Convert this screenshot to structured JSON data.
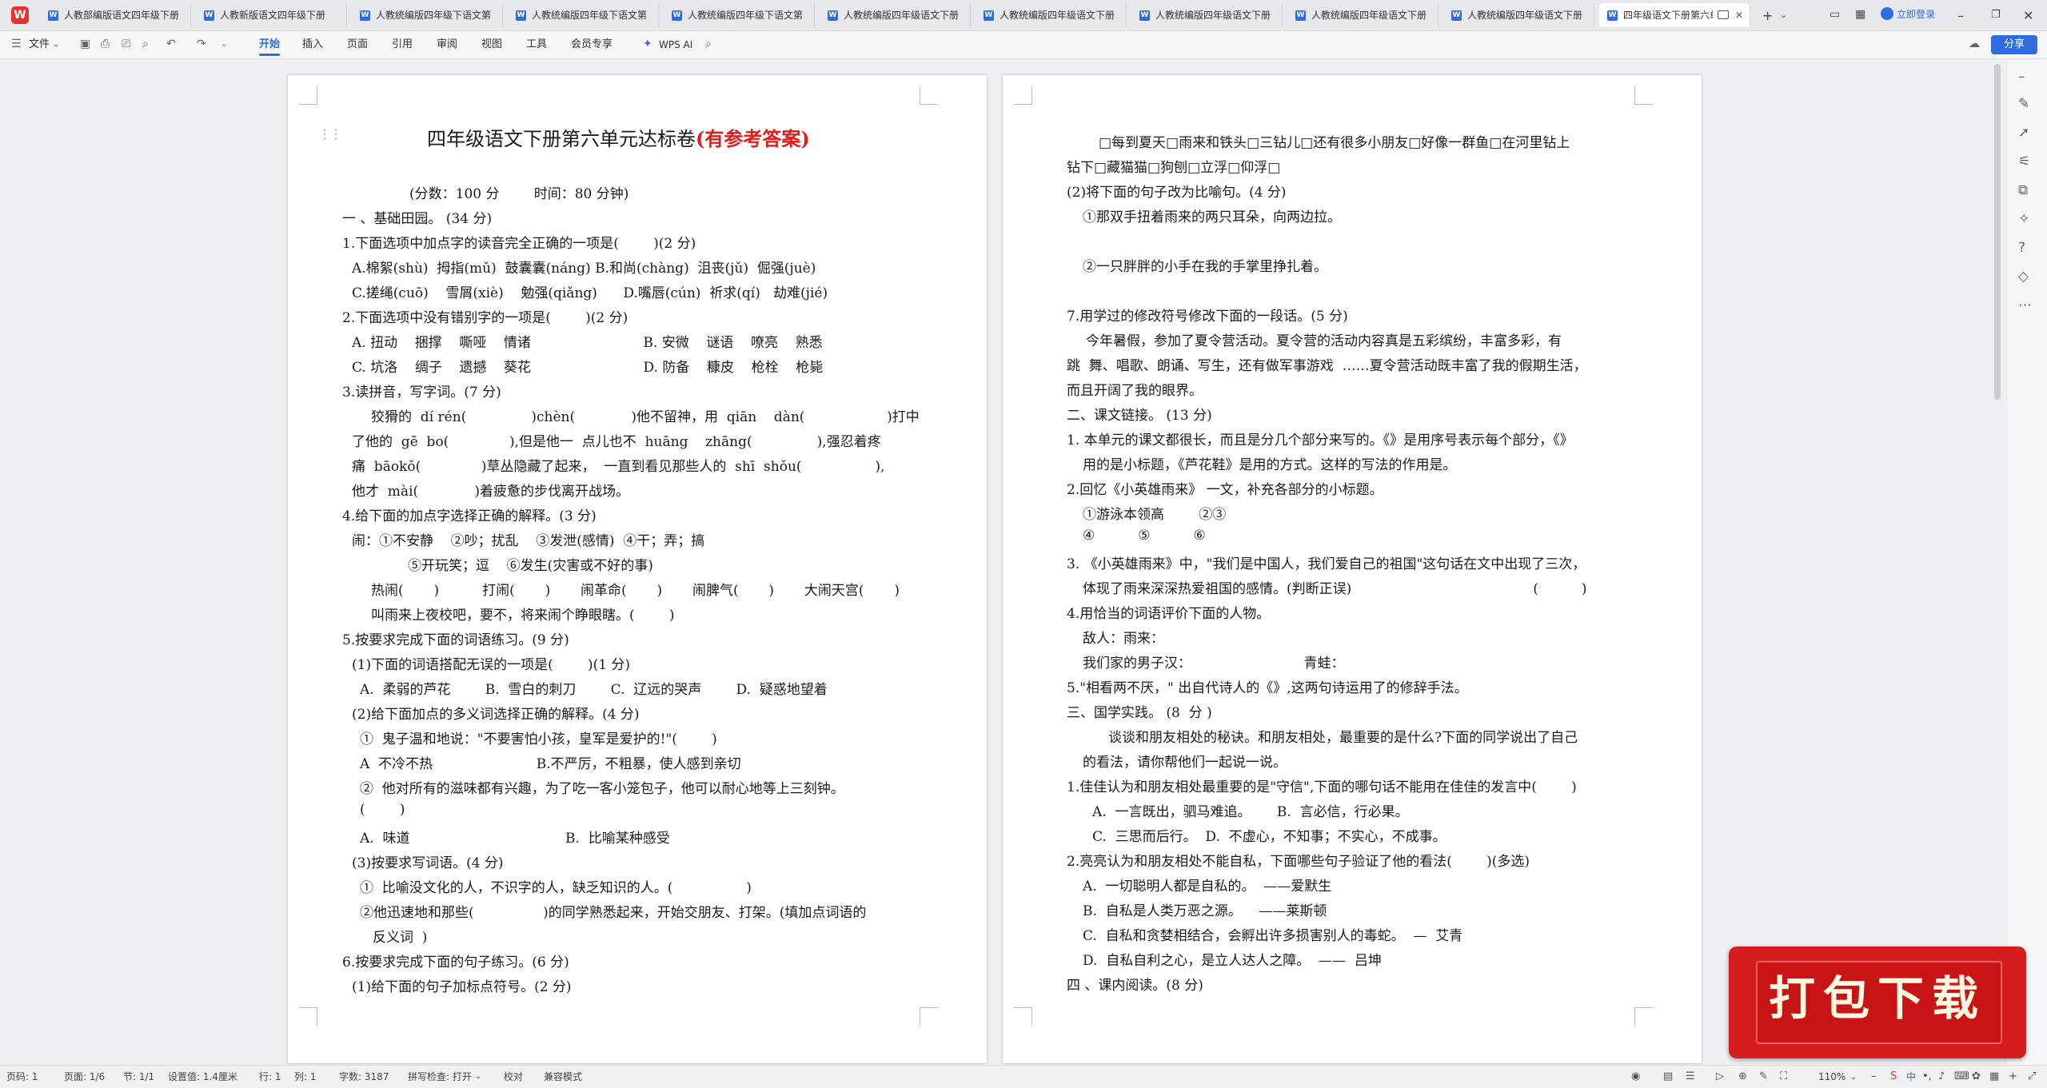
{
  "tabs": [
    {
      "label": "人教部编版语文四年级下册"
    },
    {
      "label": "人教新版语文四年级下册"
    },
    {
      "label": "人教统编版四年级下语文第"
    },
    {
      "label": "人教统编版四年级下语文第"
    },
    {
      "label": "人教统编版四年级下语文第"
    },
    {
      "label": "人教统编版四年级语文下册"
    },
    {
      "label": "人教统编版四年级语文下册"
    },
    {
      "label": "人教统编版四年级语文下册"
    },
    {
      "label": "人教统编版四年级语文下册"
    },
    {
      "label": "人教统编版四年级语文下册"
    },
    {
      "label": "四年级语文下册第六单元"
    }
  ],
  "titlebar": {
    "login": "立即登录"
  },
  "ribbon": {
    "file": "文件",
    "tabs": [
      "开始",
      "插入",
      "页面",
      "引用",
      "审阅",
      "视图",
      "工具",
      "会员专享"
    ],
    "wps_ai": "WPS AI",
    "share": "分享"
  },
  "page1": {
    "title": "四年级语文下册第六单元达标卷",
    "title_red": "(有参考答案)",
    "lines": [
      "(分数：100 分        时间：80 分钟)",
      "一 、基础田园。 (34 分)",
      "1.下面选项中加点字的读音完全正确的一项是(        )(2 分)",
      "A.棉絮(shù)  拇指(mǔ)  鼓囊囊(náng) B.和尚(chàng)  沮丧(jǔ)  倔强(juè)",
      "C.搓绳(cuō)    雪屑(xiè)    勉强(qiǎng)      D.嘴唇(cún)  祈求(qí)   劫难(jié)",
      "2.下面选项中没有错别字的一项是(        )(2 分)",
      "A. 扭动    捆撑    嘶哑    情诸                          B. 安微    谜语    嘹亮    熟悉",
      "C. 坑洛    绸子    遗撼    葵花                          D. 防备    糠皮    枪栓    枪毙",
      "3.读拼音，写字词。(7 分)",
      "狡猾的  dí rén(               )chèn(             )他不留神，用  qiān    dàn(                   )打中",
      "了他的  gē  bo(              ),但是他一  点儿也不  huāng    zhāng(               ),强忍着疼",
      "痛  bāokǒ(              )草丛隐藏了起来，  一直到看见那些人的  shī  shǒu(                 ),",
      "他才  mài(             )着疲惫的步伐离开战场。",
      "4.给下面的加点字选择正确的解释。(3 分)",
      "闹：①不安静    ②吵；扰乱    ③发泄(感情)  ④干；弄；搞",
      "⑤开玩笑；逗    ⑥发生(灾害或不好的事)",
      "热闹(       )          打闹(       )       闹革命(       )       闹脾气(       )       大闹天宫(       )",
      "叫雨来上夜校吧，要不，将来闹个睁眼瞎。(        )",
      "5.按要求完成下面的词语练习。(9 分)",
      "(1)下面的词语搭配无误的一项是(        )(1 分)",
      "A.  柔弱的芦花        B.  雪白的刺刀        C.  辽远的哭声        D.  疑惑地望着",
      "(2)给下面加点的多义词选择正确的解释。(4 分)",
      "①  鬼子温和地说：\"不要害怕小孩，皇军是爱护的!\"(        )",
      "A  不冷不热                        B.不严厉，不粗暴，使人感到亲切",
      "②  他对所有的滋味都有兴趣，为了吃一客小笼包子，他可以耐心地等上三刻钟。",
      "(        )",
      "A.  味道                                    B.  比喻某种感受",
      "(3)按要求写词语。(4 分)",
      "①  比喻没文化的人，不识字的人，缺乏知识的人。(                 )",
      "②他迅速地和那些(                )的同学熟悉起来，开始交朋友、打架。(填加点词语的",
      "反义词  )",
      "6.按要求完成下面的句子练习。(6 分)",
      "(1)给下面的句子加标点符号。(2 分)"
    ]
  },
  "page2": {
    "lines": [
      "□每到夏天□雨来和铁头□三钻儿□还有很多小朋友□好像一群鱼□在河里钻上",
      "钻下□藏猫猫□狗刨□立浮□仰浮□",
      "(2)将下面的句子改为比喻句。(4 分)",
      "①那双手扭着雨来的两只耳朵，向两边拉。",
      "②一只胖胖的小手在我的手掌里挣扎着。",
      "7.用学过的修改符号修改下面的一段话。(5 分)",
      "今年暑假，参加了夏令营活动。夏令营的活动内容真是五彩缤纷，丰富多彩，有",
      "跳  舞、唱歌、朗诵、写生，还有做军事游戏  ……夏令营活动既丰富了我的假期生活，",
      "而且开阔了我的眼界。",
      "二、课文链接。 (13 分)",
      "1. 本单元的课文都很长，而且是分几个部分来写的。《》是用序号表示每个部分，《》",
      "用的是小标题，《芦花鞋》是用的方式。这样的写法的作用是。",
      "2.回忆《小英雄雨来》 一文，补充各部分的小标题。",
      "①游泳本领高        ②③",
      "④          ⑤          ⑥",
      "3. 《小英雄雨来》中，\"我们是中国人，我们爱自己的祖国\"这句话在文中出现了三次，",
      "体现了雨来深深热爱祖国的感情。(判断正误)                                          (          )",
      "4.用恰当的词语评价下面的人物。",
      "敌人：雨来：",
      "我们家的男子汉：                          青蛙：",
      "5.\"相看两不厌，\" 出自代诗人的《》,这两句诗运用了的修辞手法。",
      "三、国学实践。 (8  分 )",
      "谈谈和朋友相处的秘诀。和朋友相处，最重要的是什么?下面的同学说出了自己",
      "的看法，请你帮他们一起说一说。",
      "1.佳佳认为和朋友相处最重要的是\"守信\",下面的哪句话不能用在佳佳的发言中(        )",
      "A.  一言既出，驷马难追。      B.  言必信，行必果。",
      "C.  三思而后行。  D.  不虚心，不知事；不实心，不成事。",
      "2.亮亮认为和朋友相处不能自私，下面哪些句子验证了他的看法(        )(多选)",
      "A.  一切聪明人都是自私的。  ——爱默生",
      "B.  自私是人类万恶之源。    ——莱斯顿",
      "C.  自私和贪婪相结合，会孵出许多损害别人的毒蛇。  —  艾青",
      "D.  自私自利之心，是立人达人之障。  ——  吕坤",
      "四 、课内阅读。(8 分)"
    ]
  },
  "status": {
    "page": "页码: 1",
    "pages": "页面: 1/6",
    "section": "节: 1/1",
    "setting": "设置值: 1.4厘米",
    "row": "行: 1",
    "col": "列: 1",
    "words": "字数: 3187",
    "spellcheck": "拼写检查: 打开",
    "proof": "校对",
    "compat": "兼容模式",
    "zoom": "110%"
  },
  "ime": {
    "lang": "中"
  },
  "banner": {
    "text": "打包下载"
  }
}
